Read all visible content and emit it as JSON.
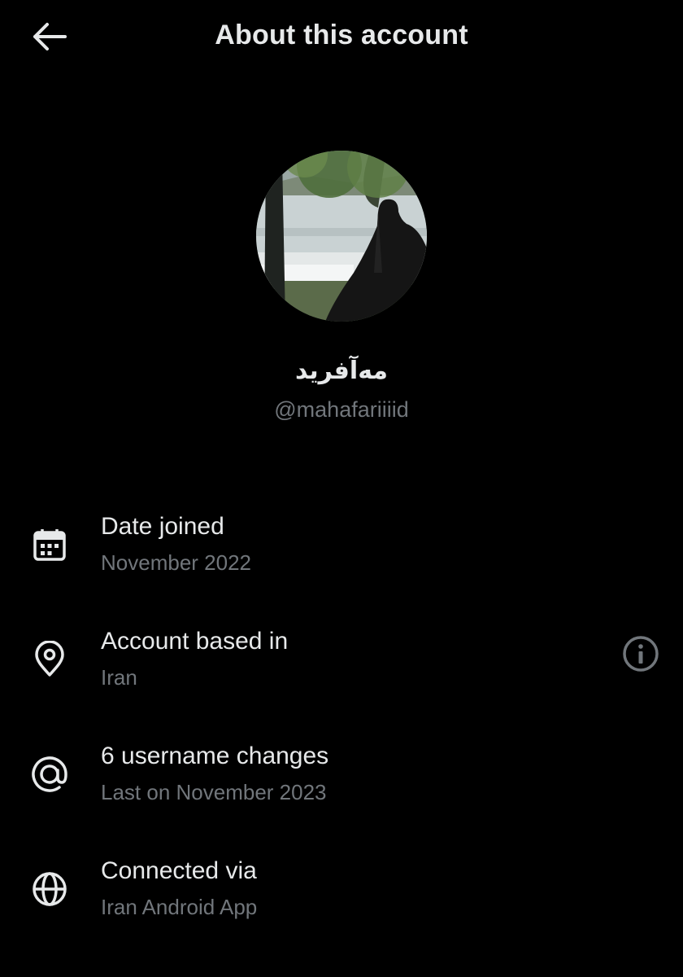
{
  "header": {
    "title": "About this account",
    "back_icon": "arrow-left-icon"
  },
  "profile": {
    "display_name": "مه‌آفرید",
    "handle": "@mahafariiiid"
  },
  "details": [
    {
      "icon": "calendar-icon",
      "label": "Date joined",
      "value": "November 2022"
    },
    {
      "icon": "location-pin-icon",
      "label": "Account based in",
      "value": "Iran",
      "action_icon": "info-icon"
    },
    {
      "icon": "at-sign-icon",
      "label": "6 username changes",
      "value": "Last on November 2023"
    },
    {
      "icon": "globe-icon",
      "label": "Connected via",
      "value": "Iran Android App"
    }
  ],
  "colors": {
    "background": "#000000",
    "primary_text": "#e7e9ea",
    "secondary_text": "#71767b"
  }
}
